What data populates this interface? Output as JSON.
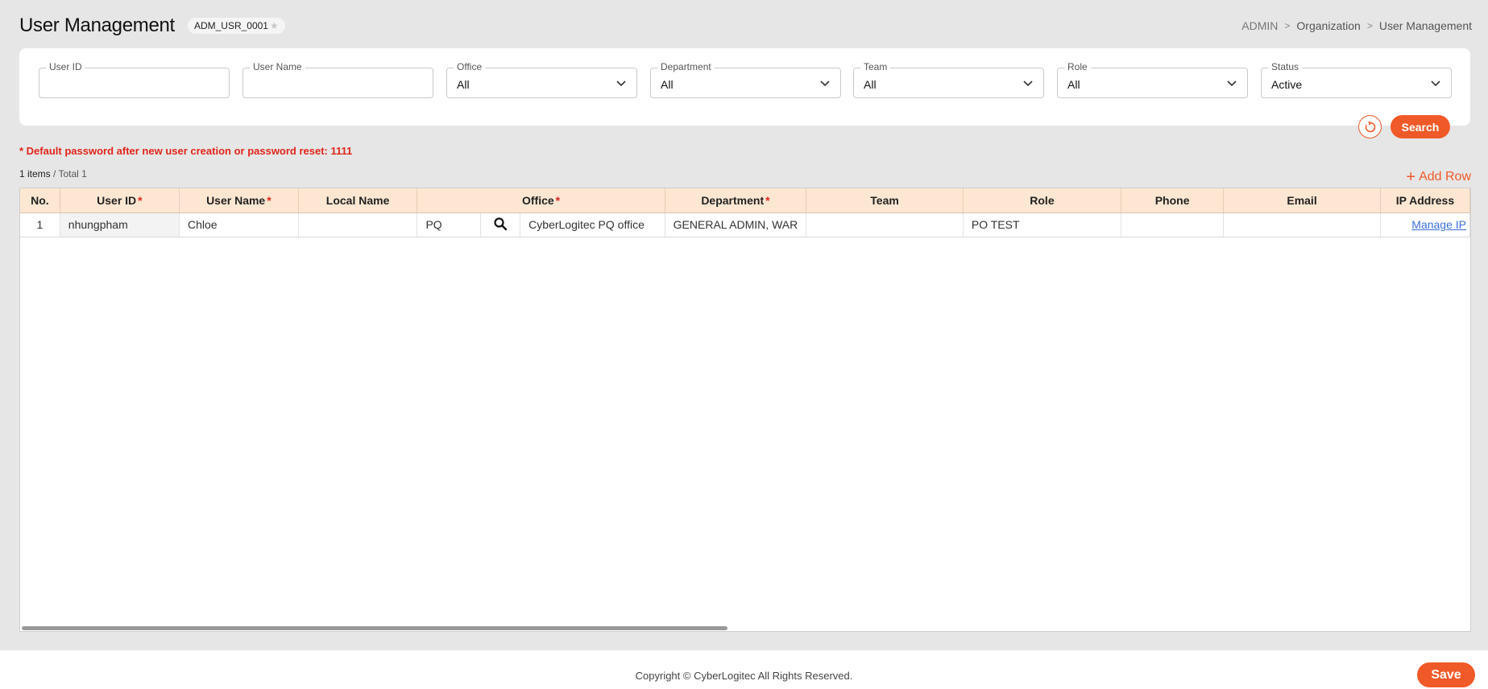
{
  "header": {
    "title": "User Management",
    "screen_code": "ADM_USR_0001",
    "breadcrumb": [
      "ADMIN",
      "Organization",
      "User Management"
    ]
  },
  "search": {
    "fields": [
      {
        "label": "User ID",
        "value": "",
        "type": "text"
      },
      {
        "label": "User Name",
        "value": "",
        "type": "text"
      },
      {
        "label": "Office",
        "value": "All",
        "type": "select"
      },
      {
        "label": "Department",
        "value": "All",
        "type": "select"
      },
      {
        "label": "Team",
        "value": "All",
        "type": "select"
      },
      {
        "label": "Role",
        "value": "All",
        "type": "select"
      },
      {
        "label": "Status",
        "value": "Active",
        "type": "select"
      }
    ],
    "search_label": "Search"
  },
  "notice": "* Default password after new user creation or password reset: 1111",
  "count": {
    "items": "1 items",
    "total": "/ Total 1"
  },
  "add_row_label": "Add Row",
  "grid": {
    "columns": [
      {
        "label": "No.",
        "required": false
      },
      {
        "label": "User ID",
        "required": true
      },
      {
        "label": "User Name",
        "required": true
      },
      {
        "label": "Local Name",
        "required": false
      },
      {
        "label": "Office",
        "required": true
      },
      {
        "label": "Department",
        "required": true
      },
      {
        "label": "Team",
        "required": false
      },
      {
        "label": "Role",
        "required": false
      },
      {
        "label": "Phone",
        "required": false
      },
      {
        "label": "Email",
        "required": false
      },
      {
        "label": "IP Address",
        "required": false
      }
    ],
    "rows": [
      {
        "no": "1",
        "user_id": "nhungpham",
        "user_name": "Chloe",
        "local_name": "",
        "office_code": "PQ",
        "office_name": "CyberLogitec PQ office",
        "department": "GENERAL ADMIN, WAR",
        "team": "",
        "role": "PO TEST",
        "phone": "",
        "email": "",
        "ip_address": "Manage IP"
      }
    ]
  },
  "footer": {
    "copyright": "Copyright © CyberLogitec All Rights Reserved.",
    "save_label": "Save"
  },
  "colors": {
    "accent": "#f05a28",
    "header_bg": "#fde7d3",
    "required": "#e0261b",
    "link": "#3b6fd8"
  }
}
